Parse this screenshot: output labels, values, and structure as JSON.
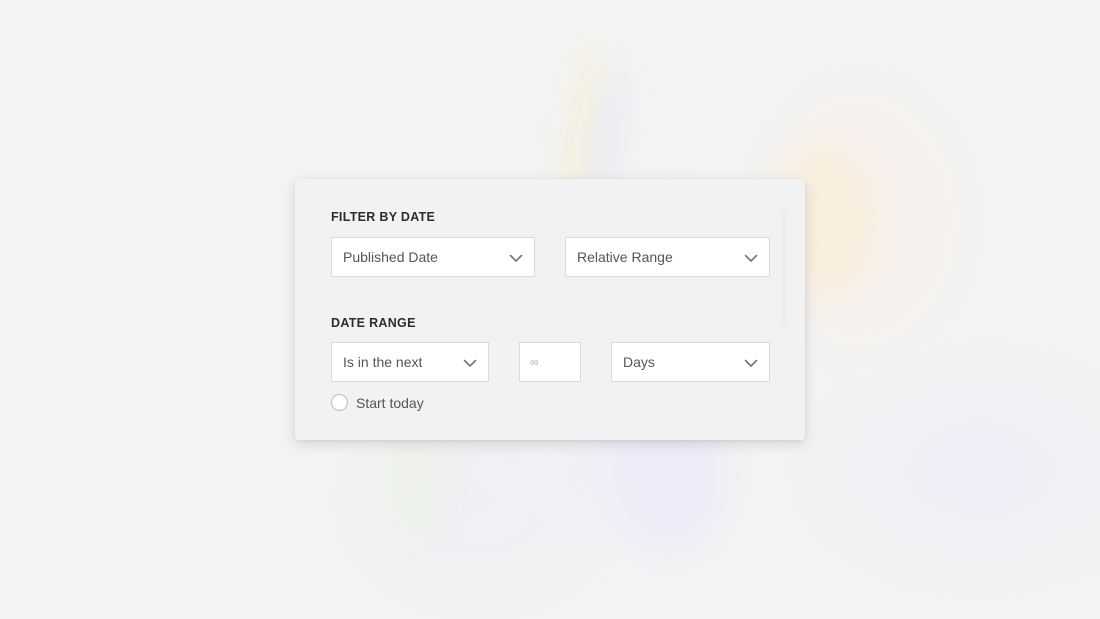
{
  "filter_by_date": {
    "label": "FILTER BY DATE",
    "date_field": {
      "selected": "Published Date"
    },
    "range_type": {
      "selected": "Relative Range"
    }
  },
  "date_range": {
    "label": "DATE RANGE",
    "operator": {
      "selected": "Is in the next"
    },
    "amount": {
      "value": "",
      "placeholder": "∞"
    },
    "unit": {
      "selected": "Days"
    }
  },
  "start_today": {
    "label": "Start today",
    "checked": false
  },
  "icons": {
    "dropdown": "chevron-down-icon",
    "checkbox": "radio-circle-icon"
  },
  "colors": {
    "background": "#f3f3f3",
    "card": "#f2f2f2",
    "label_text": "#2d2d2d",
    "field_text": "#555555",
    "field_border": "#d9d9d9"
  }
}
